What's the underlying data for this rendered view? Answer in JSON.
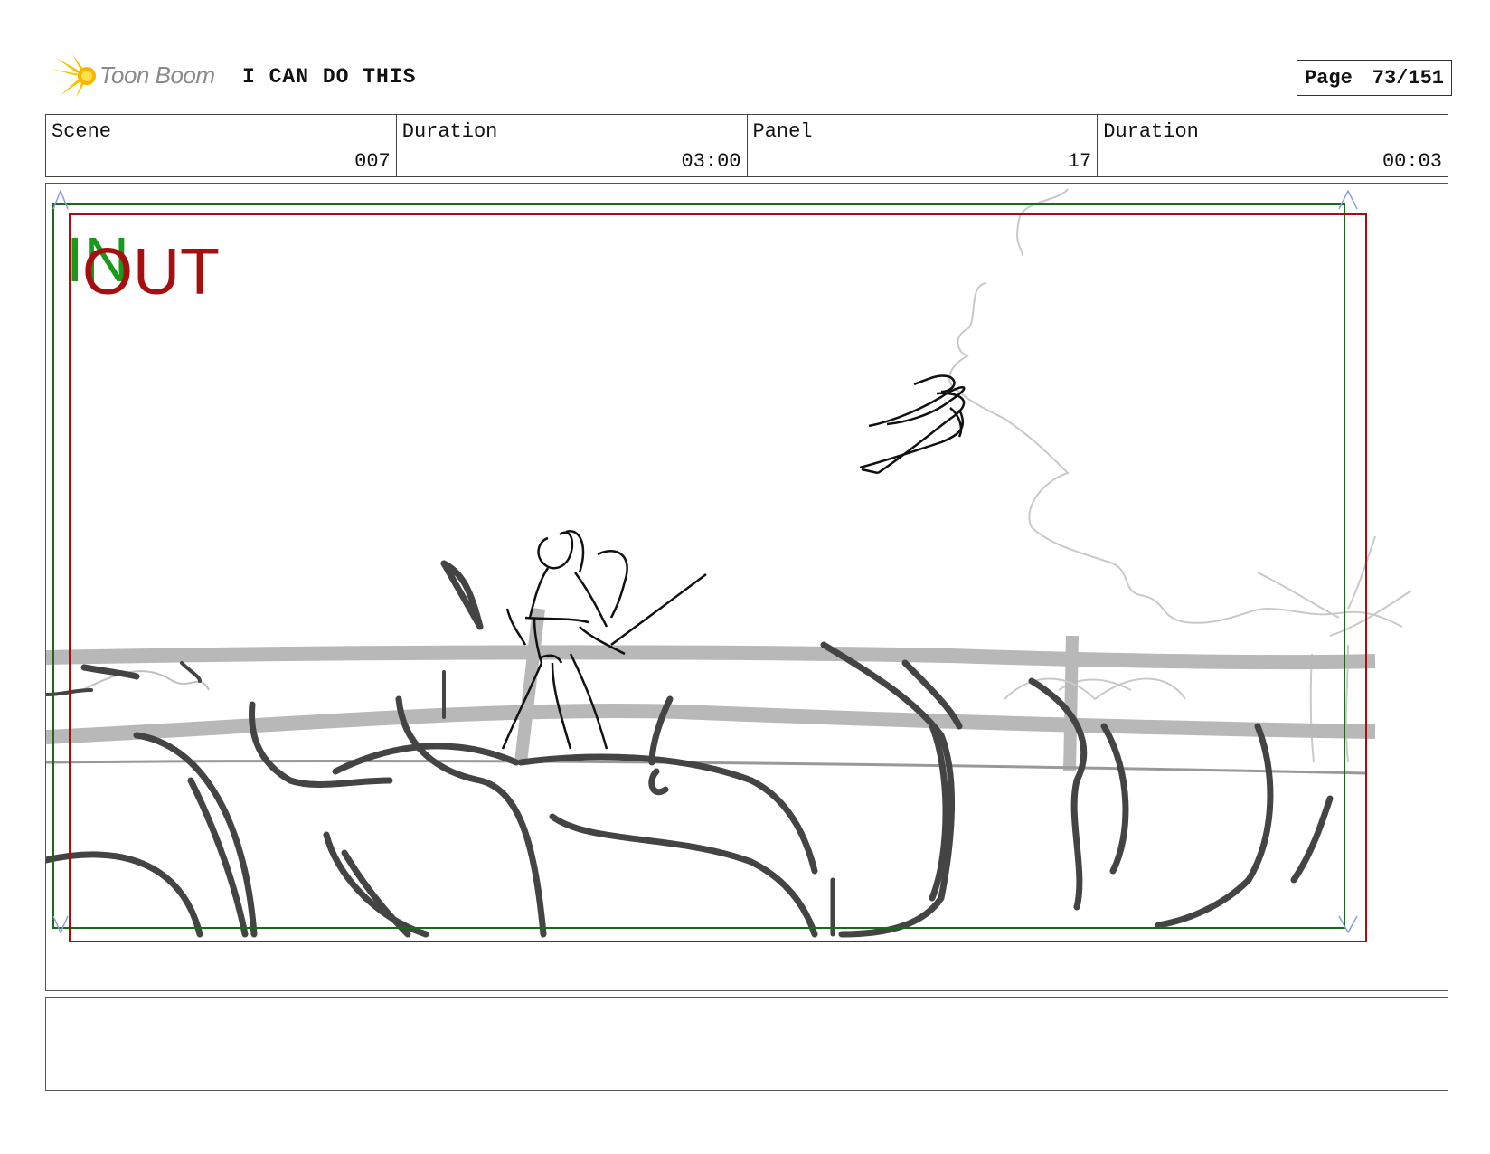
{
  "header": {
    "logo_text": "Toon Boom",
    "project_title": "I CAN DO THIS",
    "page_label": "Page",
    "page_value": "73/151"
  },
  "info": {
    "scene_label": "Scene",
    "scene_value": "007",
    "scene_duration_label": "Duration",
    "scene_duration_value": "03:00",
    "panel_label": "Panel",
    "panel_value": "17",
    "panel_duration_label": "Duration",
    "panel_duration_value": "00:03"
  },
  "frame": {
    "in_label": "IN",
    "out_label": "OUT",
    "in_color": "#1a9a1a",
    "out_color": "#a50f0f"
  },
  "notes": {
    "text": ""
  }
}
